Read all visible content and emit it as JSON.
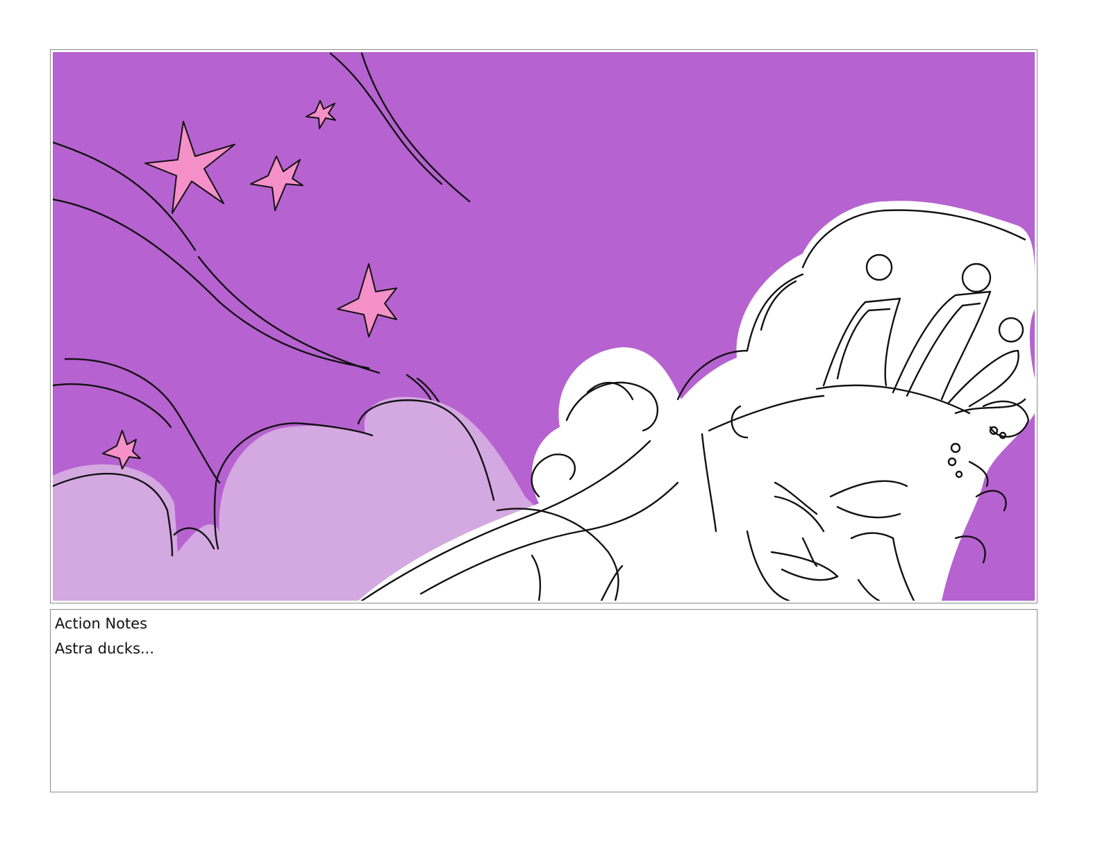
{
  "panel": {
    "background_color": "#b762d1",
    "cloud_color": "#d4a8e0",
    "star_color": "#f590c8",
    "line_color": "#111111",
    "character_fill": "#ffffff"
  },
  "notes": {
    "label": "Action Notes",
    "text": "Astra ducks..."
  }
}
